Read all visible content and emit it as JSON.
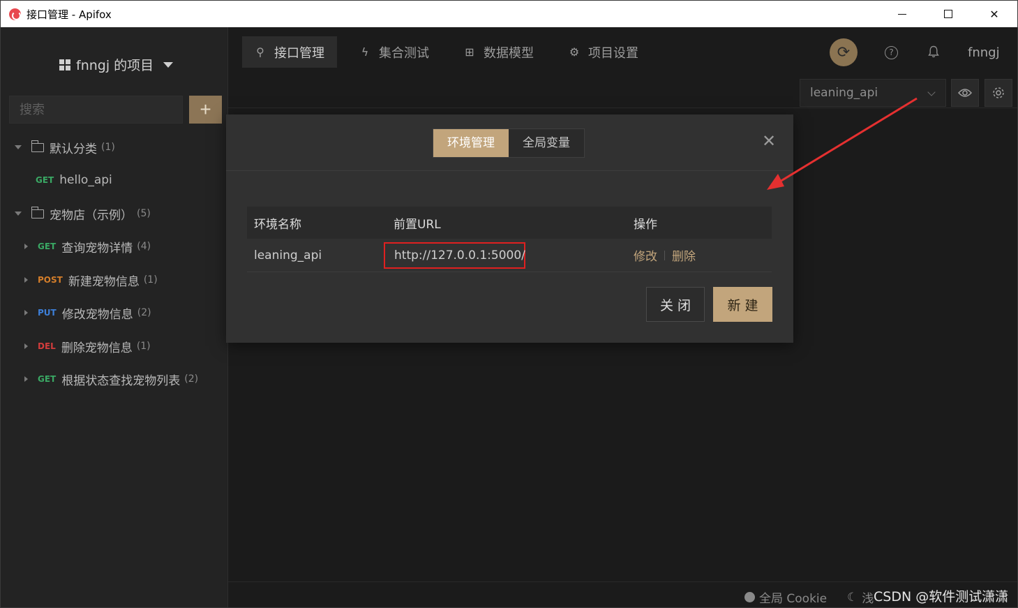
{
  "window": {
    "title": "接口管理 - Apifox"
  },
  "sidebar": {
    "project_title": "fnngj 的项目",
    "search_placeholder": "搜索",
    "add_label": "+",
    "tree": [
      {
        "type": "folder",
        "label": "默认分类",
        "count": "(1)"
      },
      {
        "type": "api",
        "method": "GET",
        "label": "hello_api",
        "count": ""
      },
      {
        "type": "folder",
        "label": "宠物店（示例）",
        "count": "(5)"
      },
      {
        "type": "api",
        "method": "GET",
        "label": "查询宠物详情",
        "count": "(4)"
      },
      {
        "type": "api",
        "method": "POST",
        "label": "新建宠物信息",
        "count": "(1)"
      },
      {
        "type": "api",
        "method": "PUT",
        "label": "修改宠物信息",
        "count": "(2)"
      },
      {
        "type": "api",
        "method": "DEL",
        "label": "删除宠物信息",
        "count": "(1)"
      },
      {
        "type": "api",
        "method": "GET",
        "label": "根据状态查找宠物列表",
        "count": "(2)"
      }
    ]
  },
  "nav": {
    "tabs": [
      {
        "label": "接口管理",
        "icon": "link-icon",
        "active": true
      },
      {
        "label": "集合测试",
        "icon": "bolt-icon",
        "active": false
      },
      {
        "label": "数据模型",
        "icon": "model-icon",
        "active": false
      },
      {
        "label": "项目设置",
        "icon": "gear-icon",
        "active": false
      }
    ],
    "user": "fnngj"
  },
  "env_selector": {
    "value": "leaning_api"
  },
  "modal": {
    "tabs": [
      {
        "label": "环境管理",
        "active": true
      },
      {
        "label": "全局变量",
        "active": false
      }
    ],
    "table": {
      "headers": [
        "环境名称",
        "前置URL",
        "操作"
      ],
      "rows": [
        {
          "name": "leaning_api",
          "url": "http://127.0.0.1:5000/",
          "edit": "修改",
          "delete": "删除"
        }
      ]
    },
    "close_label": "关闭",
    "create_label": "新建"
  },
  "footer": {
    "cookie_label": "全局 Cookie",
    "theme_label": "浅",
    "watermark": "CSDN @软件测试潇潇"
  },
  "colors": {
    "accent": "#c2a57c",
    "highlight_box": "#e02020",
    "get": "#3aa864",
    "post": "#d47e2a",
    "put": "#3d7fd8",
    "del": "#d23c3c"
  }
}
